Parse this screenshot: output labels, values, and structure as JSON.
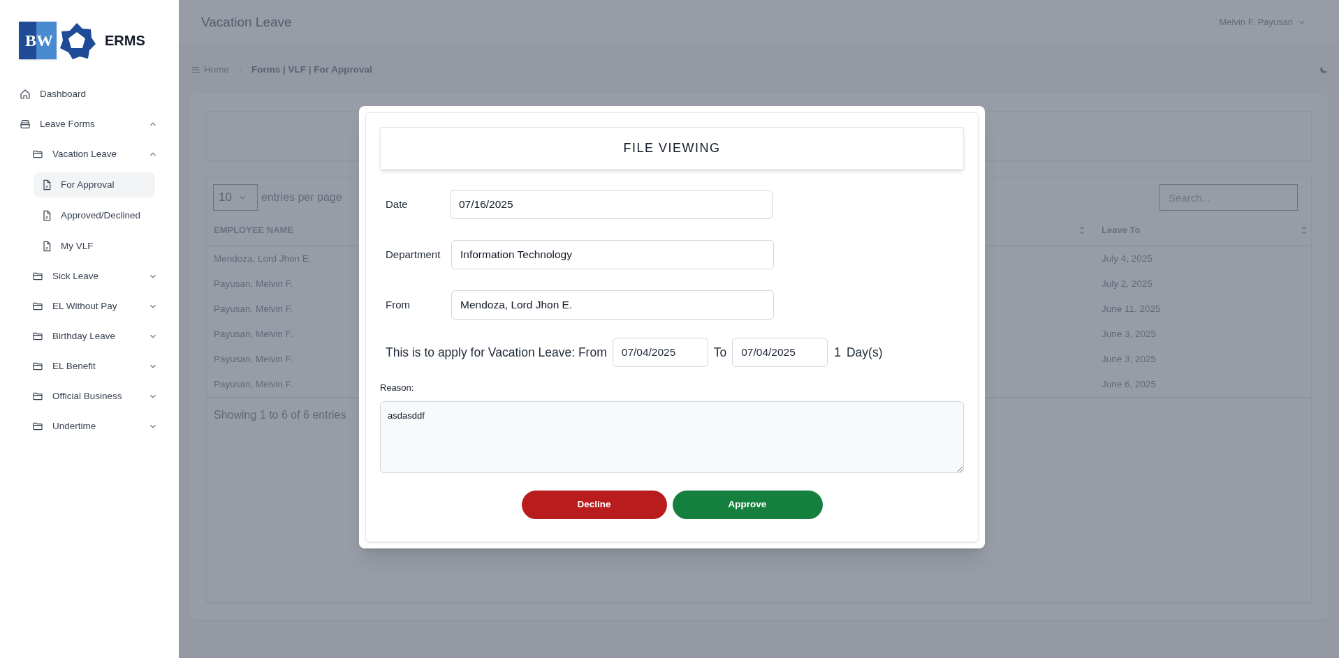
{
  "logo": {
    "mark_left": "B",
    "mark_right": "W",
    "name": "ERMS"
  },
  "sidebar": {
    "items": [
      {
        "label": "Dashboard",
        "selected": false
      },
      {
        "label": "Leave Forms",
        "selected": false,
        "expanded": true,
        "children": [
          {
            "label": "Vacation Leave",
            "selected": false,
            "expanded": true,
            "children": [
              {
                "label": "For Approval",
                "selected": true
              },
              {
                "label": "Approved/Declined",
                "selected": false
              },
              {
                "label": "My VLF",
                "selected": false
              }
            ]
          },
          {
            "label": "Sick Leave",
            "selected": false,
            "expanded": false
          },
          {
            "label": "EL Without Pay",
            "selected": false,
            "expanded": false
          },
          {
            "label": "Birthday Leave",
            "selected": false,
            "expanded": false
          },
          {
            "label": "EL Benefit",
            "selected": false,
            "expanded": false
          },
          {
            "label": "Official Business",
            "selected": false,
            "expanded": false
          },
          {
            "label": "Undertime",
            "selected": false,
            "expanded": false
          }
        ]
      }
    ]
  },
  "header": {
    "title": "Vacation Leave",
    "user": "Melvin F. Payusan"
  },
  "breadcrumb": {
    "home": "Home",
    "current": "Forms | VLF | For Approval"
  },
  "table": {
    "page_size": "10",
    "page_size_label": "entries per page",
    "search_placeholder": "Search...",
    "columns": [
      {
        "label": "EMPLOYEE NAME"
      },
      {
        "label": "Leave To"
      }
    ],
    "rows": [
      {
        "employee_name": "Mendoza, Lord Jhon E.",
        "leave_to": "July 4, 2025"
      },
      {
        "employee_name": "Payusan, Melvin F.",
        "leave_to": "July 2, 2025"
      },
      {
        "employee_name": "Payusan, Melvin F.",
        "leave_to": "June 11, 2025"
      },
      {
        "employee_name": "Payusan, Melvin F.",
        "leave_to": "June 3, 2025"
      },
      {
        "employee_name": "Payusan, Melvin F.",
        "leave_to": "June 3, 2025"
      },
      {
        "employee_name": "Payusan, Melvin F.",
        "leave_to": "June 6, 2025"
      }
    ],
    "footer": "Showing 1 to 6 of 6 entries"
  },
  "modal": {
    "title": "FILE VIEWING",
    "fields": [
      {
        "label": "Date",
        "value": "07/16/2025"
      },
      {
        "label": "Department",
        "value": "Information Technology"
      },
      {
        "label": "From",
        "value": "Mendoza, Lord Jhon E."
      }
    ],
    "apply": {
      "text": "This is to apply for Vacation Leave: From",
      "from": "07/04/2025",
      "to_label": "To",
      "to": "07/04/2025",
      "days": "1",
      "days_label": "Day(s)"
    },
    "reason_label": "Reason:",
    "reason": "asdasddf",
    "buttons": [
      {
        "label": "Decline",
        "kind": "danger"
      },
      {
        "label": "Approve",
        "kind": "success"
      }
    ]
  }
}
